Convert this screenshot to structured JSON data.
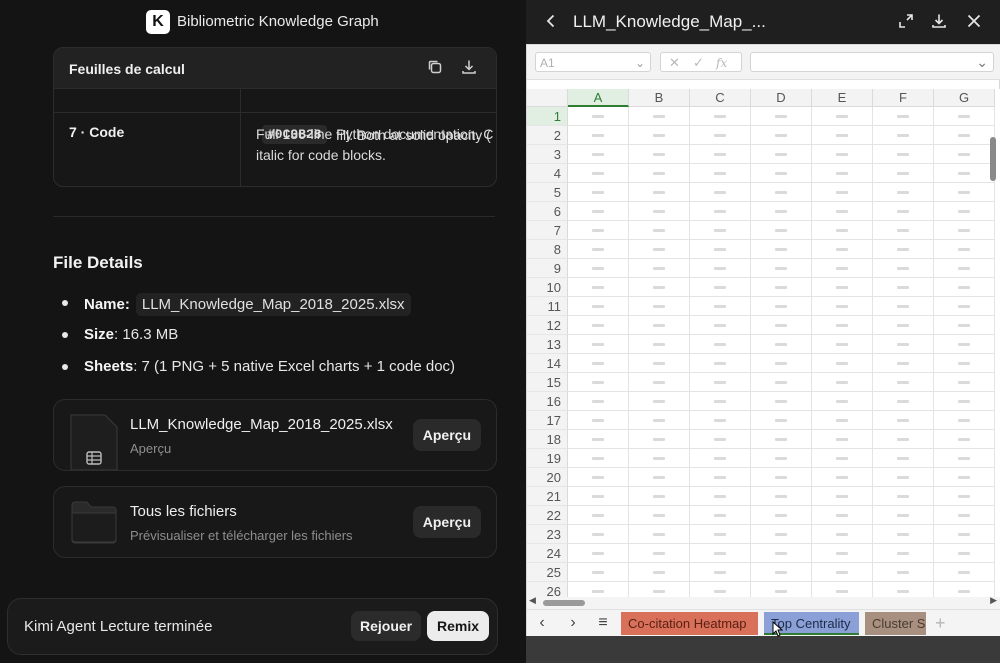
{
  "app": {
    "logo_letter": "K",
    "title": "Bibliometric Knowledge Graph"
  },
  "sheets_card": {
    "title": "Feuilles de calcul",
    "prev_hex": "#0C0B28",
    "prev_text": "fill. Both at solid opacity (",
    "row_label": "7 · Code",
    "row_text_line1": "Full 136-line Python documentation. C",
    "row_text_line2": "italic for code blocks."
  },
  "file_details": {
    "title": "File Details",
    "name_label": "Name:",
    "name_value": "LLM_Knowledge_Map_2018_2025.xlsx",
    "size_label": "Size",
    "size_value": ": 16.3 MB",
    "sheets_label": "Sheets",
    "sheets_value": ": 7 (1 PNG + 5 native Excel charts + 1 code doc)"
  },
  "file_card": {
    "name": "LLM_Knowledge_Map_2018_2025.xlsx",
    "sub": "Aperçu",
    "button": "Aperçu"
  },
  "all_files_card": {
    "name": "Tous les fichiers",
    "sub": "Prévisualiser et télécharger les fichiers",
    "button": "Aperçu"
  },
  "bottom_bar": {
    "status": "Kimi Agent Lecture terminée",
    "replay": "Rejouer",
    "remix": "Remix"
  },
  "preview": {
    "title": "LLM_Knowledge_Map_...",
    "namebox": "A1",
    "columns": [
      "A",
      "B",
      "C",
      "D",
      "E",
      "F",
      "G"
    ],
    "rows": [
      "1",
      "2",
      "3",
      "4",
      "5",
      "6",
      "7",
      "8",
      "9",
      "10",
      "11",
      "12",
      "13",
      "14",
      "15",
      "16",
      "17",
      "18",
      "19",
      "20",
      "21",
      "22",
      "23",
      "24",
      "25",
      "26"
    ],
    "tabs": [
      {
        "label": "Co-citation Heatmap",
        "color": "#d9705a"
      },
      {
        "label": "Top Centrality",
        "color": "#8aa0d6"
      },
      {
        "label": "Cluster S",
        "color": "#a89080"
      }
    ],
    "add_tab": "+"
  }
}
